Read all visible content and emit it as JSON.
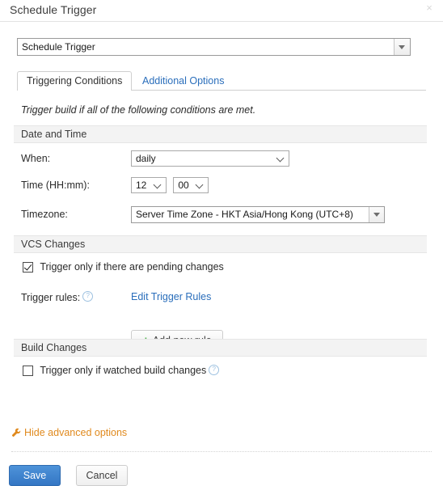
{
  "dialog": {
    "title": "Schedule Trigger",
    "close_label": "×"
  },
  "trigger_type": {
    "selected": "Schedule Trigger"
  },
  "tabs": [
    {
      "label": "Triggering Conditions",
      "active": true
    },
    {
      "label": "Additional Options",
      "active": false
    }
  ],
  "intro": "Trigger build if all of the following conditions are met.",
  "sections": {
    "date_and_time": {
      "title": "Date and Time",
      "when": {
        "label": "When:",
        "value": "daily"
      },
      "time": {
        "label": "Time (HH:mm):",
        "hour": "12",
        "minute": "00"
      },
      "timezone": {
        "label": "Timezone:",
        "value": "Server Time Zone - HKT Asia/Hong Kong (UTC+8)"
      }
    },
    "vcs_changes": {
      "title": "VCS Changes",
      "pending_changes": {
        "label": "Trigger only if there are pending changes",
        "checked": true
      },
      "trigger_rules": {
        "label": "Trigger rules:",
        "help": "?",
        "edit_link": "Edit Trigger Rules",
        "add_rule_button": "Add new rule",
        "add_rule_icon": "+"
      }
    },
    "build_changes": {
      "title": "Build Changes",
      "watched_build": {
        "label": "Trigger only if watched build changes",
        "checked": false,
        "help": "?"
      }
    }
  },
  "advanced_toggle": {
    "label": "Hide advanced options",
    "icon": "wrench-icon"
  },
  "footer": {
    "save_label": "Save",
    "cancel_label": "Cancel"
  },
  "colors": {
    "link": "#2a6ebb",
    "accent_orange": "#e08a1e",
    "save_blue": "#3476c4",
    "plus_green": "#4fb34f"
  }
}
